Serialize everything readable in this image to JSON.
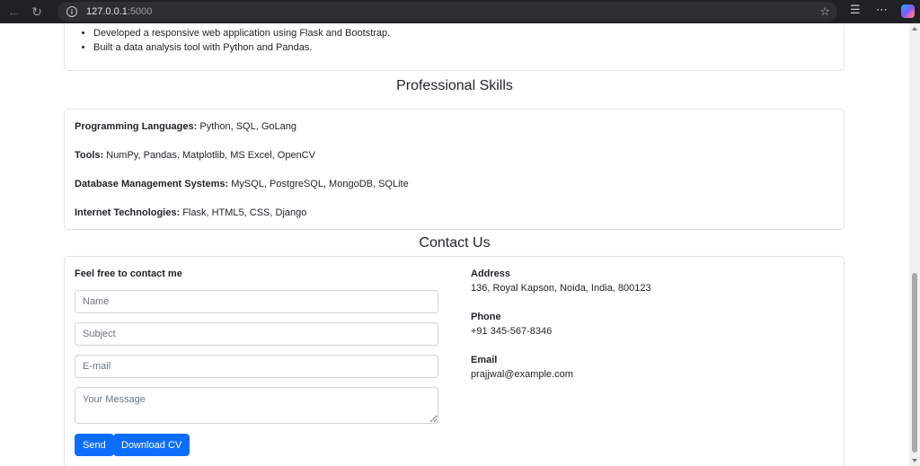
{
  "browser": {
    "url_host": "127.0.0.1",
    "url_port": ":5000"
  },
  "projects": {
    "items": [
      "Developed a responsive web application using Flask and Bootstrap.",
      "Built a data analysis tool with Python and Pandas."
    ]
  },
  "skills": {
    "title": "Professional Skills",
    "lines": [
      {
        "label": "Programming Languages:",
        "value": " Python, SQL, GoLang"
      },
      {
        "label": "Tools:",
        "value": " NumPy, Pandas, Matplotlib, MS Excel, OpenCV"
      },
      {
        "label": "Database Management Systems:",
        "value": " MySQL, PostgreSQL, MongoDB, SQLite"
      },
      {
        "label": "Internet Technologies:",
        "value": " Flask, HTML5, CSS, Django"
      }
    ]
  },
  "contact": {
    "title": "Contact Us",
    "lead": "Feel free to contact me",
    "placeholders": {
      "name": "Name",
      "subject": "Subject",
      "email": "E-mail",
      "message": "Your Message"
    },
    "send_label": "Send",
    "download_label": "Download CV",
    "address_label": "Address",
    "address_value": "136, Royal Kapson, Noida, India, 800123",
    "phone_label": "Phone",
    "phone_value": "+91 345-567-8346",
    "email_label": "Email",
    "email_value": "prajjwal@example.com"
  }
}
